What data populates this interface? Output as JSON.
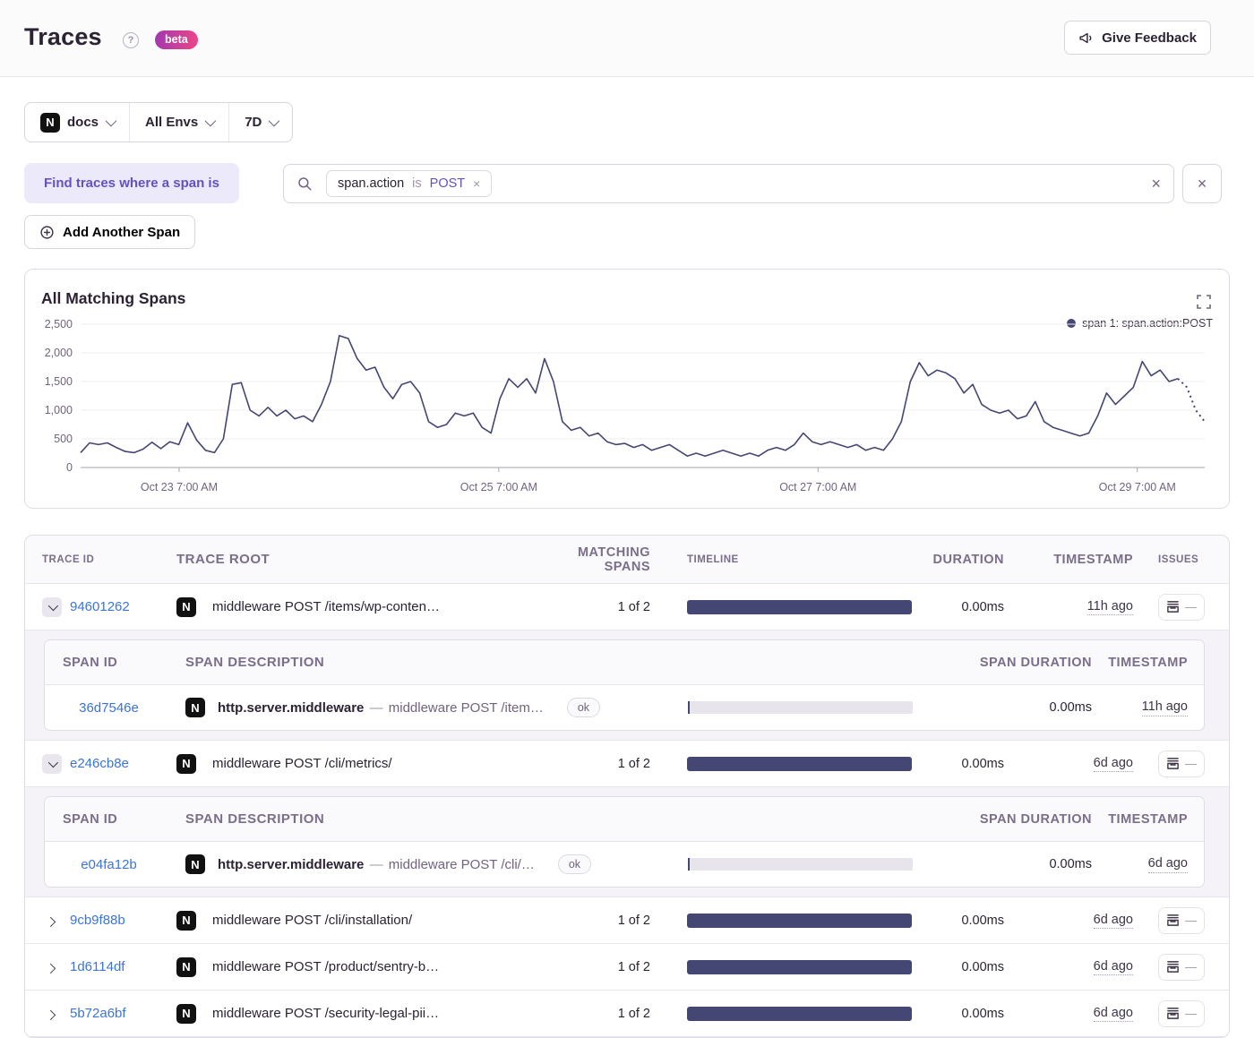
{
  "header": {
    "title": "Traces",
    "beta_label": "beta",
    "feedback_label": "Give Feedback"
  },
  "filters": {
    "project": "docs",
    "environment": "All Envs",
    "period": "7D"
  },
  "span_query": {
    "chip_label": "Find traces where a span is",
    "token": {
      "key": "span.action",
      "op": "is",
      "value": "POST"
    },
    "add_span_label": "Add Another Span"
  },
  "chart_data": {
    "type": "line",
    "title": "All Matching Spans",
    "legend_label": "span 1: span.action:POST",
    "line_color": "#444674",
    "ylim": [
      0,
      2500
    ],
    "y_ticks": [
      "0",
      "500",
      "1,000",
      "1,500",
      "2,000",
      "2,500"
    ],
    "x_ticks": [
      {
        "label": "Oct 23 7:00 AM",
        "frac": 0.0876
      },
      {
        "label": "Oct 25 7:00 AM",
        "frac": 0.372
      },
      {
        "label": "Oct 27 7:00 AM",
        "frac": 0.656
      },
      {
        "label": "Oct 29 7:00 AM",
        "frac": 0.94
      }
    ],
    "dashed_tail_points": 3,
    "values": [
      260,
      430,
      400,
      430,
      350,
      280,
      260,
      320,
      440,
      330,
      450,
      400,
      780,
      480,
      300,
      260,
      500,
      1450,
      1480,
      1000,
      900,
      1050,
      900,
      1000,
      850,
      900,
      800,
      1100,
      1500,
      2300,
      2250,
      1900,
      1700,
      1750,
      1400,
      1200,
      1450,
      1500,
      1300,
      800,
      700,
      750,
      950,
      900,
      950,
      700,
      600,
      1200,
      1550,
      1400,
      1550,
      1300,
      1900,
      1500,
      800,
      650,
      700,
      550,
      600,
      450,
      400,
      420,
      350,
      400,
      300,
      350,
      400,
      300,
      200,
      250,
      200,
      250,
      300,
      250,
      200,
      250,
      200,
      300,
      350,
      300,
      400,
      600,
      450,
      400,
      450,
      400,
      350,
      400,
      300,
      350,
      300,
      500,
      800,
      1500,
      1830,
      1600,
      1700,
      1650,
      1550,
      1300,
      1450,
      1100,
      1000,
      950,
      1000,
      850,
      900,
      1150,
      800,
      700,
      650,
      600,
      550,
      600,
      900,
      1300,
      1100,
      1250,
      1400,
      1850,
      1600,
      1700,
      1500,
      1550,
      1400,
      1000,
      800
    ]
  },
  "table": {
    "columns": {
      "trace_id": "Trace ID",
      "trace_root": "Trace Root",
      "matching_spans": "Matching Spans",
      "timeline": "Timeline",
      "duration": "Duration",
      "timestamp": "Timestamp",
      "issues": "Issues"
    },
    "sub_columns": {
      "span_id": "Span ID",
      "span_description": "Span Description",
      "span_duration": "Span Duration",
      "timestamp": "Timestamp"
    },
    "rows": [
      {
        "trace_id": "94601262",
        "root": "middleware POST /items/wp-conten…",
        "matching": "1 of 2",
        "duration": "0.00ms",
        "timestamp": "11h ago",
        "span": {
          "id": "36d7546e",
          "op": "http.server.middleware",
          "sep": "—",
          "desc": "middleware POST /item…",
          "status": "ok",
          "duration": "0.00ms",
          "timestamp": "11h ago"
        }
      },
      {
        "trace_id": "e246cb8e",
        "root": "middleware POST /cli/metrics/",
        "matching": "1 of 2",
        "duration": "0.00ms",
        "timestamp": "6d ago",
        "span": {
          "id": "e04fa12b",
          "op": "http.server.middleware",
          "sep": "—",
          "desc": "middleware POST /cli/…",
          "status": "ok",
          "duration": "0.00ms",
          "timestamp": "6d ago"
        }
      },
      {
        "trace_id": "9cb9f88b",
        "root": "middleware POST /cli/installation/",
        "matching": "1 of 2",
        "duration": "0.00ms",
        "timestamp": "6d ago"
      },
      {
        "trace_id": "1d6114df",
        "root": "middleware POST /product/sentry-b…",
        "matching": "1 of 2",
        "duration": "0.00ms",
        "timestamp": "6d ago"
      },
      {
        "trace_id": "5b72a6bf",
        "root": "middleware POST /security-legal-pii…",
        "matching": "1 of 2",
        "duration": "0.00ms",
        "timestamp": "6d ago"
      }
    ]
  }
}
